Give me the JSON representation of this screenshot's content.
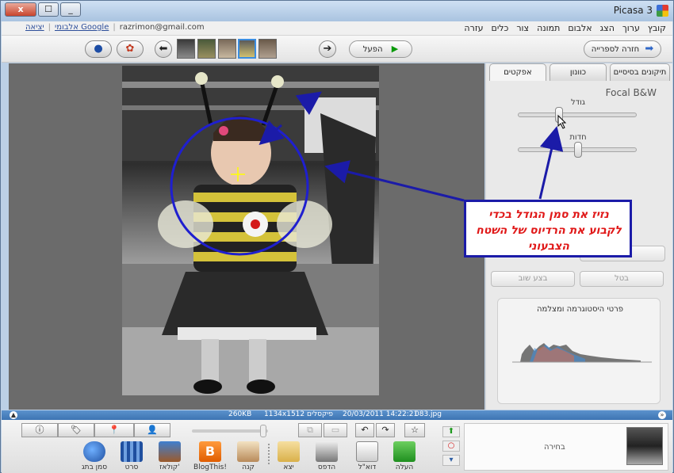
{
  "window": {
    "title": "Picasa 3",
    "close_label": "x",
    "max_label": "☐",
    "min_label": "_"
  },
  "menubar": {
    "items": [
      "קובץ",
      "ערוך",
      "הצג",
      "אלבום",
      "תמונה",
      "צור",
      "כלים",
      "עזרה"
    ],
    "email": "razrimon@gmail.com",
    "account_link": "אלבומי Google",
    "exit_link": "יציאה"
  },
  "toolbar": {
    "library_label": "חזרה לספרייה",
    "play_label": "הפעל",
    "prev_icon": "arrow-left-icon",
    "next_icon": "arrow-right-icon",
    "thumb_count": 6,
    "selected_thumb": 4
  },
  "panel": {
    "tabs": [
      "אפקטים",
      "כוונון",
      "תיקונים בסיסיים"
    ],
    "active_tab": "אפקטים",
    "effect_name": "Focal B&W",
    "size_label": "גודל",
    "sharpness_label": "חדות",
    "size_value": 0.33,
    "sharpness_value": 0.5,
    "apply_label": "החל",
    "cancel_label": "בטל",
    "redo_label": "בצע שוב",
    "histogram_title": "פרטי היסטוגרמה ומצלמה"
  },
  "statusbar": {
    "filename": "083.jpg",
    "datetime": "20/03/2011 14:22:21",
    "dimensions": "1134x1512 פיקסלים",
    "size": "260KB"
  },
  "tray": {
    "buttons": [
      {
        "icon": "upload-icon",
        "label": "העלה"
      },
      {
        "icon": "email-icon",
        "label": "דוא\"ל"
      },
      {
        "icon": "print-icon",
        "label": "הדפס"
      },
      {
        "icon": "export-icon",
        "label": "יצא"
      },
      {
        "icon": "shop-icon",
        "label": "קנה"
      },
      {
        "icon": "blogger-icon",
        "label": "BlogThis!"
      },
      {
        "icon": "collage-icon",
        "label": "קולאז'"
      },
      {
        "icon": "movie-icon",
        "label": "סרט"
      },
      {
        "icon": "geotag-icon",
        "label": "סמן בתג"
      }
    ],
    "selection_label": "בחירה"
  },
  "annotation": {
    "text": "נזיז את סמן הגודל בכדי לקבוע את הרדיוס של השטח הצבעוני",
    "color": "#1b1ba8",
    "text_color": "#e01818"
  },
  "colors": {
    "accent": "#3b8de0",
    "status_blue": "#3d74b3"
  }
}
